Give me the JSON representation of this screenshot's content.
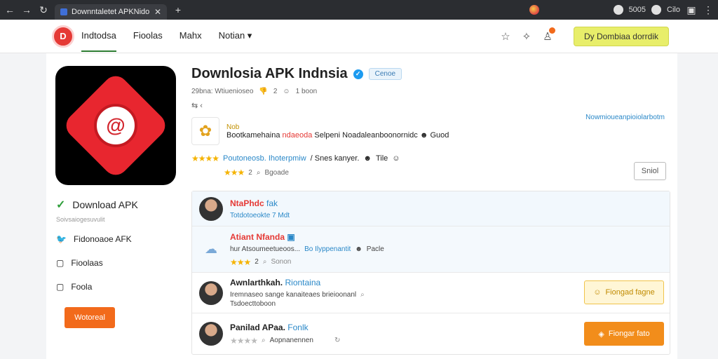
{
  "browser": {
    "tab_title": "Downntaletet APKNidonicas",
    "new_tab": "+",
    "right_labels": [
      "5005",
      "Cilo"
    ]
  },
  "topbar": {
    "nav": [
      "Indtodsa",
      "Fioolas",
      "Mahx",
      "Notian ▾"
    ],
    "download_button": "Dy Dombiaa dorrdik"
  },
  "sidebar": {
    "primary": "Download APK",
    "primary_sub": "Soivsaiogesuvulit",
    "items": [
      "Fidonoaoe AFK",
      "Fioolaas",
      "Foola"
    ],
    "button": "Wotoreal"
  },
  "app": {
    "title": "Downlosia APK Indnsia",
    "chip": "Cenoe",
    "meta": [
      "29bna: Wtiuenioseo",
      "2",
      "1 boon"
    ],
    "desc_label": "Nob",
    "desc_pre": "Bootkamehaina ",
    "desc_highlight": "ndaeoda",
    "desc_post": " Selpeni Noadaleanboonornidc",
    "desc_tail": "Guod",
    "more_link": "Nowmioueanpioiolarbotm",
    "rating_blue": "Poutoneosb.  Ihoterpmiw",
    "rating_rest": "/ Snes kanyer.",
    "rating_tail": "Tile",
    "rating2_count": "2",
    "rating2_label": "Bgoade",
    "small_button": "Sniol"
  },
  "reviews": [
    {
      "name": "NtaPhdc",
      "name_tag": "fak",
      "line": "Totdotoeokte 7 Mdt"
    },
    {
      "name": "Atiant Nfanda",
      "line": "hur Atsoumeetueoos... ",
      "line_hl": "Bo Ilyppenantit",
      "line_tail": "Pacle",
      "count": "2",
      "label": "Sonon"
    },
    {
      "name": "Awnlarthkah.",
      "name_tag": "Riontaina",
      "line": "Iremnaseo sange kanaiteaes brieioonanl",
      "sub": "Tsdoecttoboon",
      "button": "Fiongad fagne"
    },
    {
      "name": "Panilad APaa.",
      "name_tag": "Fonlk",
      "line": "Aopnanennen",
      "button": "Fiongar fato"
    }
  ]
}
